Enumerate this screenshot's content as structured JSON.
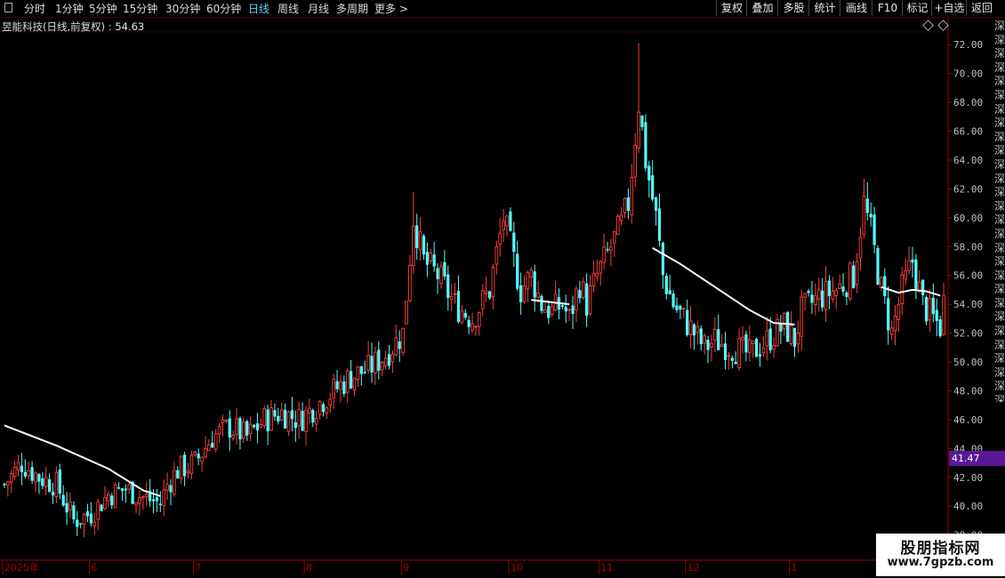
{
  "toolbar": {
    "periods": [
      "分时",
      "1分钟",
      "5分钟",
      "15分钟",
      "30分钟",
      "60分钟",
      "日线",
      "周线",
      "月线",
      "多周期",
      "更多 >"
    ],
    "active_period": "日线",
    "right_buttons": [
      "复权",
      "叠加",
      "多股",
      "统计",
      "画线",
      "F10",
      "标记",
      "+自选",
      "返回"
    ]
  },
  "stock": {
    "title": "昱能科技(日线,前复权)",
    "sep": ":",
    "value": "54.63"
  },
  "price_tag": "41.47",
  "side_text": "深深深深深深深深深深深深深深深深深深深深深深深深深深深深深深深深深深深深深深深深深深深深深深深深深深深深深深深深深深深深深深深深深深深深深深",
  "watermark": {
    "title": "股朋指标网",
    "url": "www.7gpzb.com"
  },
  "colors": {
    "up": "#ff3d3d",
    "down": "#54ffff",
    "trend": "#ffffff",
    "grid": "#3a0000",
    "axis": "#a00000"
  },
  "chart_data": {
    "type": "candlestick",
    "title": "昱能科技(日线,前复权)",
    "y_ticks": [
      "72.00",
      "70.00",
      "68.00",
      "66.00",
      "64.00",
      "62.00",
      "60.00",
      "58.00",
      "56.00",
      "54.00",
      "52.00",
      "50.00",
      "48.00",
      "46.00",
      "44.00",
      "42.00",
      "40.00",
      "38.00"
    ],
    "ylim": [
      36.5,
      73
    ],
    "x_ticks": [
      "2025年",
      "6",
      "7",
      "8",
      "9",
      "10",
      "11",
      "12",
      "1"
    ],
    "x_tick_index": [
      0,
      25,
      55,
      87,
      115,
      146,
      172,
      197,
      227
    ],
    "n_bars": 272,
    "last_close": 54.63,
    "current_price_marker": 41.47,
    "anchors": [
      [
        0,
        41.5
      ],
      [
        5,
        43.0
      ],
      [
        10,
        42.0
      ],
      [
        15,
        41.5
      ],
      [
        20,
        39.0
      ],
      [
        25,
        39.5
      ],
      [
        30,
        40.8
      ],
      [
        35,
        41.2
      ],
      [
        40,
        40.6
      ],
      [
        45,
        40.2
      ],
      [
        47,
        41.5
      ],
      [
        50,
        42.5
      ],
      [
        55,
        43.0
      ],
      [
        60,
        44.8
      ],
      [
        65,
        45.5
      ],
      [
        70,
        44.8
      ],
      [
        75,
        46.0
      ],
      [
        80,
        46.5
      ],
      [
        85,
        46.0
      ],
      [
        90,
        47.0
      ],
      [
        95,
        48.0
      ],
      [
        100,
        49.0
      ],
      [
        105,
        49.5
      ],
      [
        110,
        50.5
      ],
      [
        115,
        52.0
      ],
      [
        118,
        60.0
      ],
      [
        121,
        57.0
      ],
      [
        125,
        56.0
      ],
      [
        130,
        54.0
      ],
      [
        135,
        53.0
      ],
      [
        140,
        55.0
      ],
      [
        144,
        60.0
      ],
      [
        146,
        58.0
      ],
      [
        149,
        55.0
      ],
      [
        152,
        56.0
      ],
      [
        155,
        54.0
      ],
      [
        158,
        53.5
      ],
      [
        161,
        54.0
      ],
      [
        163,
        53.0
      ],
      [
        166,
        55.5
      ],
      [
        168,
        54.0
      ],
      [
        171,
        56.0
      ],
      [
        175,
        58.0
      ],
      [
        178,
        59.5
      ],
      [
        180,
        61.0
      ],
      [
        183,
        68.0
      ],
      [
        185,
        64.0
      ],
      [
        188,
        60.0
      ],
      [
        190,
        56.0
      ],
      [
        193,
        54.0
      ],
      [
        196,
        53.0
      ],
      [
        199,
        52.0
      ],
      [
        202,
        51.0
      ],
      [
        205,
        51.5
      ],
      [
        210,
        51.0
      ],
      [
        215,
        50.5
      ],
      [
        220,
        51.5
      ],
      [
        225,
        52.5
      ],
      [
        228,
        51.5
      ],
      [
        230,
        53.5
      ],
      [
        235,
        54.5
      ],
      [
        240,
        55.0
      ],
      [
        245,
        56.0
      ],
      [
        248,
        61.0
      ],
      [
        250,
        59.0
      ],
      [
        253,
        55.0
      ],
      [
        256,
        52.0
      ],
      [
        259,
        55.0
      ],
      [
        262,
        57.0
      ],
      [
        265,
        54.0
      ],
      [
        268,
        53.0
      ],
      [
        271,
        52.2
      ]
    ],
    "trendlines": [
      {
        "points": [
          [
            0,
            45.6
          ],
          [
            15,
            44.2
          ],
          [
            30,
            42.6
          ],
          [
            40,
            41.1
          ],
          [
            45,
            40.7
          ]
        ]
      },
      {
        "points": [
          [
            152,
            54.3
          ],
          [
            163,
            54.0
          ]
        ]
      },
      {
        "points": [
          [
            187,
            57.9
          ],
          [
            195,
            56.8
          ],
          [
            205,
            55.2
          ],
          [
            215,
            53.6
          ],
          [
            222,
            52.7
          ],
          [
            228,
            52.6
          ]
        ]
      },
      {
        "points": [
          [
            253,
            55.2
          ],
          [
            258,
            54.8
          ],
          [
            262,
            55.0
          ],
          [
            266,
            54.9
          ],
          [
            270,
            54.6
          ]
        ]
      }
    ]
  }
}
